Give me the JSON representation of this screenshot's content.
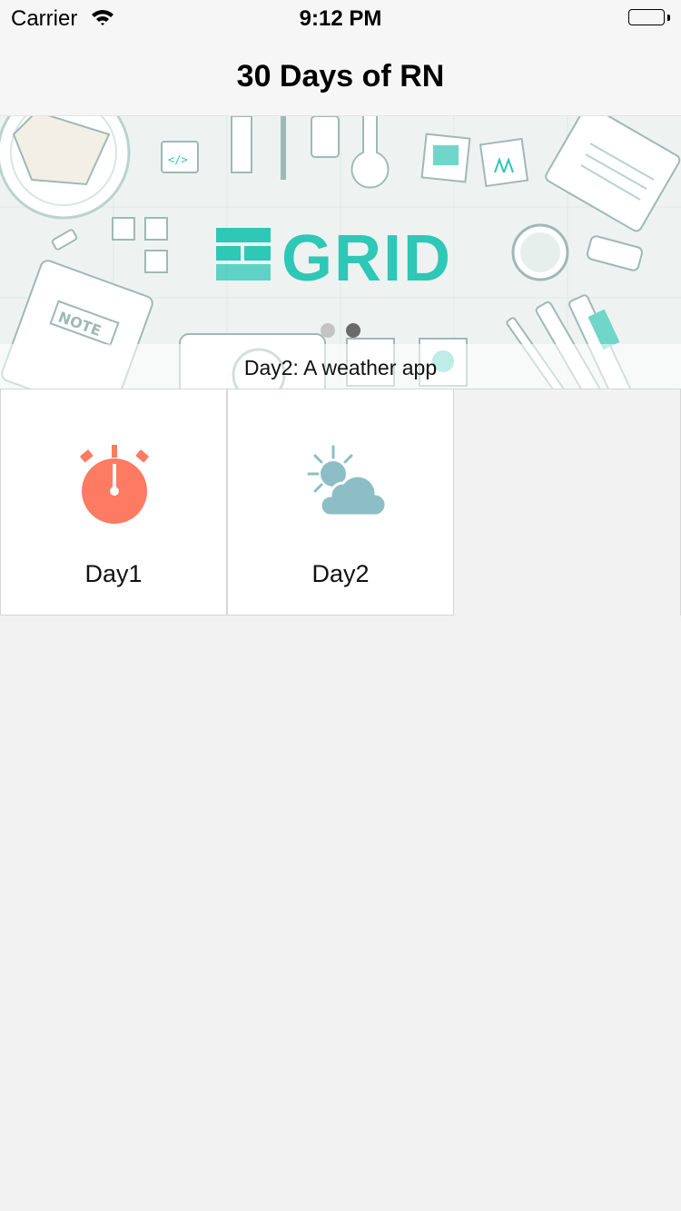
{
  "status_bar": {
    "carrier": "Carrier",
    "time": "9:12 PM",
    "wifi_icon": "wifi-icon",
    "battery_icon": "battery-icon"
  },
  "nav": {
    "title": "30 Days of RN"
  },
  "banner": {
    "logo_text": "GRID",
    "note_text": "NOTE",
    "caption": "Day2: A weather app",
    "page_count": 2,
    "active_page": 2,
    "colors": {
      "brand": "#2fc7b6",
      "background": "#eef3f1",
      "line": "#9fb9b4"
    }
  },
  "grid": {
    "items": [
      {
        "label": "Day1",
        "icon": "stopwatch-icon",
        "color": "#fc7b62"
      },
      {
        "label": "Day2",
        "icon": "partly-cloudy-icon",
        "color": "#8ebec5"
      }
    ]
  }
}
